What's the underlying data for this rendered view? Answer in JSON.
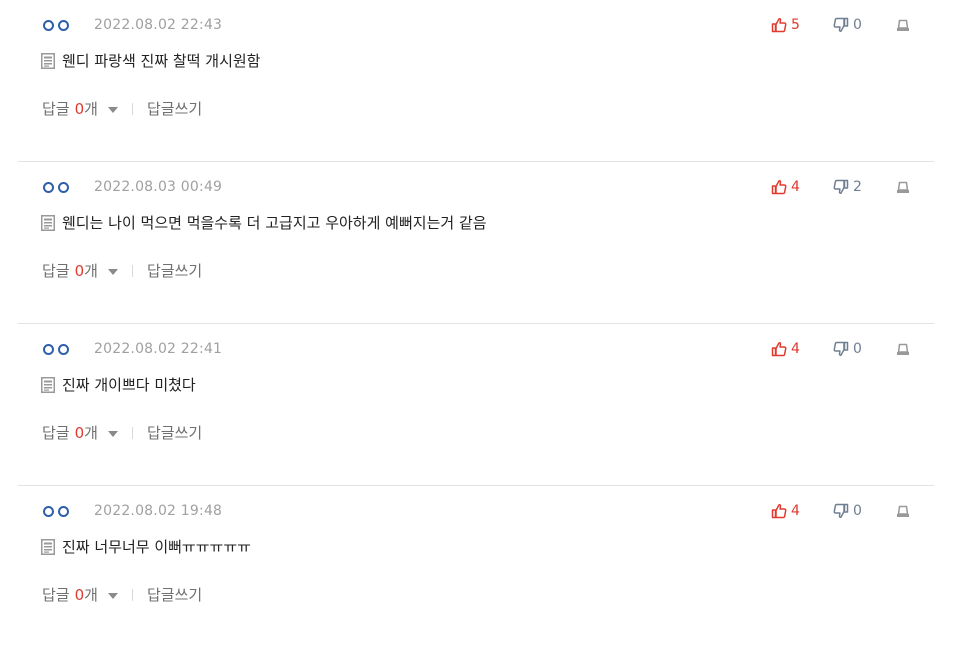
{
  "comments": [
    {
      "date": "2022.08.02 22:43",
      "likes": "5",
      "dislikes": "0",
      "text": "웬디 파랑색 진짜 찰떡 개시원함",
      "reply_label": "답글",
      "reply_count": "0",
      "reply_unit": "개",
      "write_reply": "답글쓰기"
    },
    {
      "date": "2022.08.03 00:49",
      "likes": "4",
      "dislikes": "2",
      "text": "웬디는 나이 먹으면 먹을수록 더 고급지고 우아하게 예뻐지는거 같음",
      "reply_label": "답글",
      "reply_count": "0",
      "reply_unit": "개",
      "write_reply": "답글쓰기"
    },
    {
      "date": "2022.08.02 22:41",
      "likes": "4",
      "dislikes": "0",
      "text": "진짜 개이쁘다 미쳤다",
      "reply_label": "답글",
      "reply_count": "0",
      "reply_unit": "개",
      "write_reply": "답글쓰기"
    },
    {
      "date": "2022.08.02 19:48",
      "likes": "4",
      "dislikes": "0",
      "text": "진짜 너무너무 이뻐ㅠㅠㅠㅠㅠ",
      "reply_label": "답글",
      "reply_count": "0",
      "reply_unit": "개",
      "write_reply": "답글쓰기"
    }
  ],
  "colors": {
    "like": "#e03a2f",
    "dislike": "#6f7f92",
    "nick_dots": "#2f5fa8",
    "separator": "#e2e2e2"
  },
  "icons": {
    "nickname": "blind-nickname-dots-icon",
    "like": "thumbs-up-icon",
    "dislike": "thumbs-down-icon",
    "report": "report-flag-icon",
    "text": "document-icon",
    "expand": "caret-down-icon"
  }
}
